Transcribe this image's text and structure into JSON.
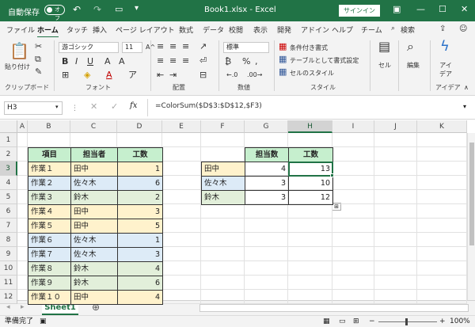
{
  "titlebar": {
    "autosave": "自動保存",
    "autosave_state": "オフ",
    "filename": "Book1.xlsx  -  Excel",
    "signin": "サインイン"
  },
  "tabs": [
    "ファイル",
    "ホーム",
    "タッチ",
    "挿入",
    "ページ レイアウト",
    "数式",
    "データ",
    "校閲",
    "表示",
    "開発",
    "アドイン",
    "ヘルプ",
    "チーム",
    "検索"
  ],
  "ribbon": {
    "paste": "貼り付け",
    "clipboard": "クリップボード",
    "font_name": "游ゴシック",
    "font_size": "11",
    "font_label": "フォント",
    "align_label": "配置",
    "number_format": "標準",
    "number_label": "数値",
    "cond_format": "条件付き書式",
    "table_format": "テーブルとして書式設定",
    "cell_style": "セルのスタイル",
    "style_label": "スタイル",
    "cells": "セル",
    "editing": "編集",
    "ideas": "アイデア",
    "ideas_label": "アイデア"
  },
  "formula_bar": {
    "name_box": "H3",
    "fx": "fx",
    "formula": "=ColorSum($D$3:$D$12,$F3)"
  },
  "columns": [
    "A",
    "B",
    "C",
    "D",
    "E",
    "F",
    "G",
    "H",
    "I",
    "J",
    "K"
  ],
  "rows": [
    "1",
    "2",
    "3",
    "4",
    "5",
    "6",
    "7",
    "8",
    "9",
    "10",
    "11",
    "12"
  ],
  "table1": {
    "headers": [
      "項目",
      "担当者",
      "工数"
    ],
    "rows": [
      [
        "作業１",
        "田中",
        "1"
      ],
      [
        "作業２",
        "佐々木",
        "6"
      ],
      [
        "作業３",
        "鈴木",
        "2"
      ],
      [
        "作業４",
        "田中",
        "3"
      ],
      [
        "作業５",
        "田中",
        "5"
      ],
      [
        "作業６",
        "佐々木",
        "1"
      ],
      [
        "作業７",
        "佐々木",
        "3"
      ],
      [
        "作業８",
        "鈴木",
        "4"
      ],
      [
        "作業９",
        "鈴木",
        "6"
      ],
      [
        "作業１０",
        "田中",
        "4"
      ]
    ]
  },
  "table2": {
    "headers": [
      "担当数",
      "工数"
    ],
    "rows": [
      [
        "田中",
        "4",
        "13"
      ],
      [
        "佐々木",
        "3",
        "10"
      ],
      [
        "鈴木",
        "3",
        "12"
      ]
    ]
  },
  "sheet": {
    "tab": "Sheet1"
  },
  "status": {
    "ready": "準備完了",
    "zoom": "100%"
  },
  "colors": {
    "excel_green": "#217346",
    "header_fill": "#c6efce",
    "yellow": "#fff2cc",
    "blue": "#ddebf7",
    "green": "#e2efda"
  }
}
